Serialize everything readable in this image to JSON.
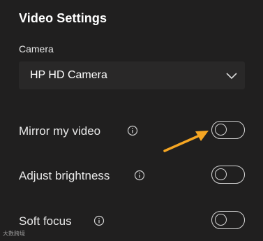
{
  "panel": {
    "title": "Video Settings",
    "camera_label": "Camera",
    "camera_value": "HP HD Camera"
  },
  "settings": [
    {
      "label": "Mirror my video",
      "enabled": false,
      "icon": "info-icon"
    },
    {
      "label": "Adjust brightness",
      "enabled": false,
      "icon": "info-icon"
    },
    {
      "label": "Soft focus",
      "enabled": false,
      "icon": "info-icon"
    }
  ],
  "annotation": {
    "icon": "arrow-icon",
    "color": "#f5a623"
  },
  "watermark": "大数跨境",
  "colors": {
    "background": "#201f1f",
    "dropdown": "#292828",
    "toggle_border": "#d6d6d6"
  }
}
